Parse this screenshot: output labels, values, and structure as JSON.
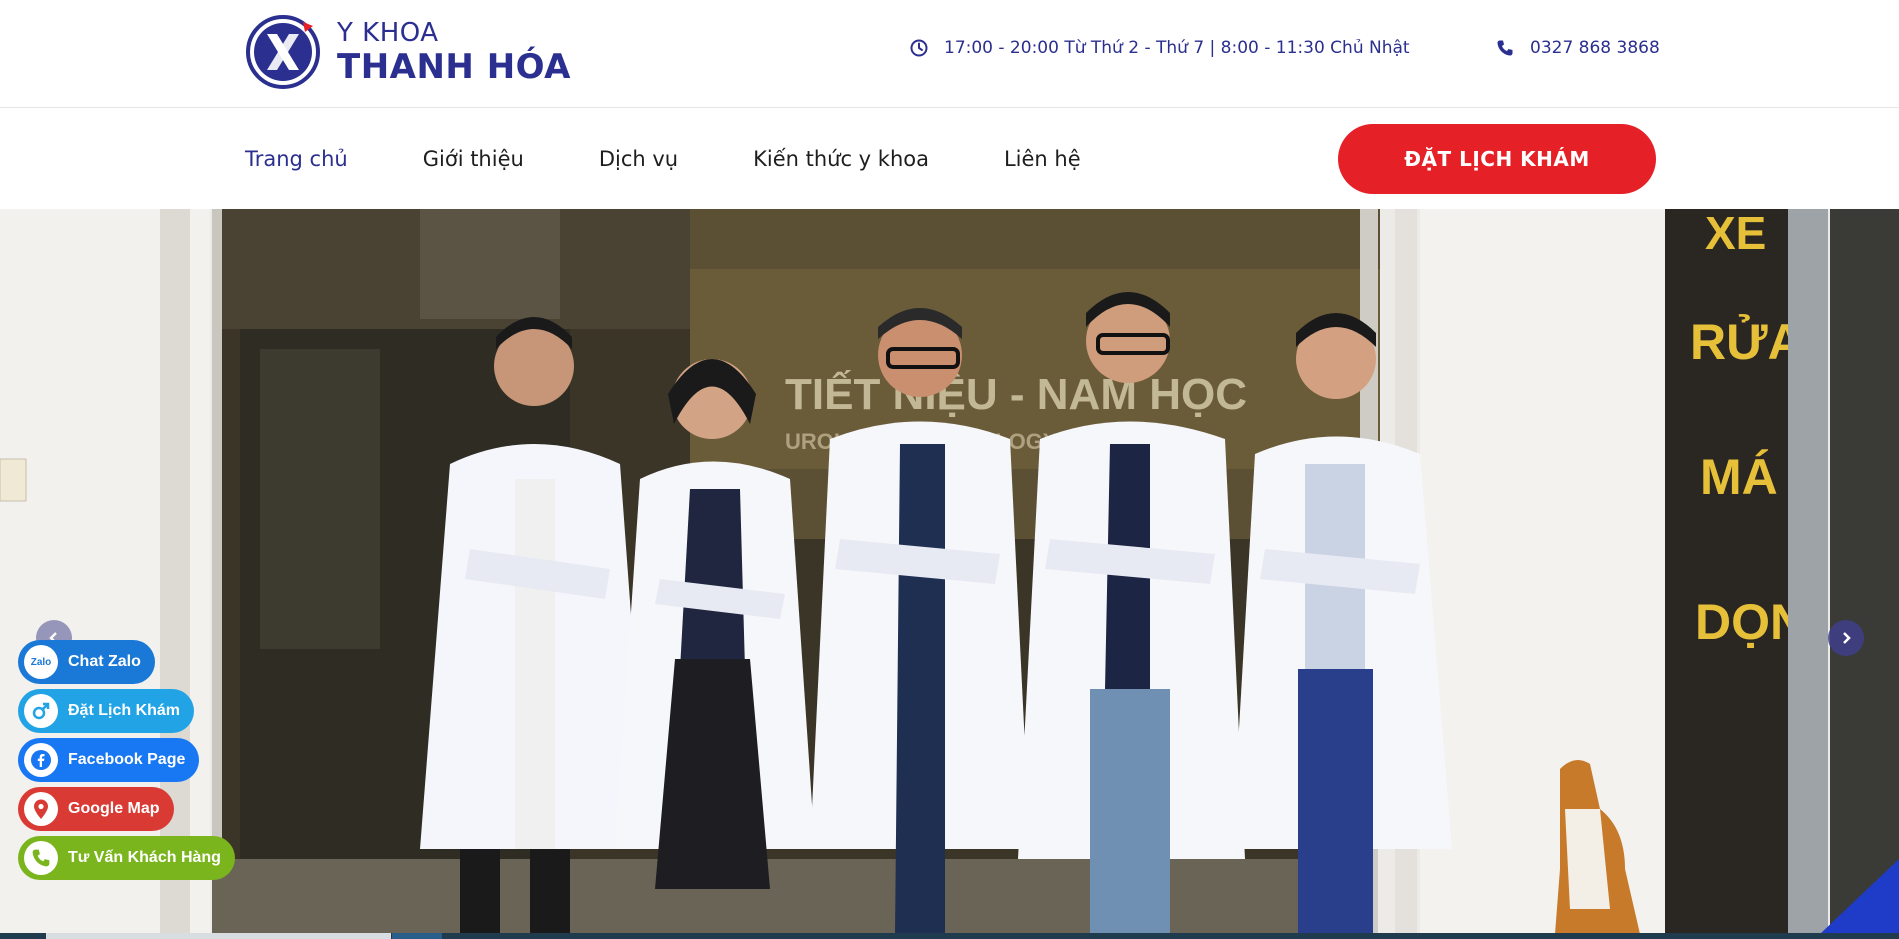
{
  "brand": {
    "line1": "Y KHOA",
    "line2": "THANH HÓA",
    "logo_icon": "x-logo-icon",
    "color": "#2b2f8f"
  },
  "header": {
    "hours": "17:00 - 20:00 Từ Thứ 2 - Thứ 7 | 8:00 - 11:30 Chủ Nhật",
    "phone": "0327 868 3868"
  },
  "nav": {
    "items": [
      {
        "label": "Trang chủ"
      },
      {
        "label": "Giới thiệu"
      },
      {
        "label": "Dịch vụ"
      },
      {
        "label": "Kiến thức y khoa"
      },
      {
        "label": "Liên hệ"
      }
    ],
    "cta_label": "ĐẶT LỊCH KHÁM",
    "cta_color": "#e52027"
  },
  "hero": {
    "prev_icon": "chevron-left-icon",
    "next_icon": "chevron-right-icon"
  },
  "contact": {
    "zalo": "Chat Zalo",
    "zalo_badge": "Zalo",
    "book": "Đặt Lịch Khám",
    "facebook": "Facebook Page",
    "map": "Google Map",
    "advice": "Tư Vấn Khách Hàng"
  }
}
